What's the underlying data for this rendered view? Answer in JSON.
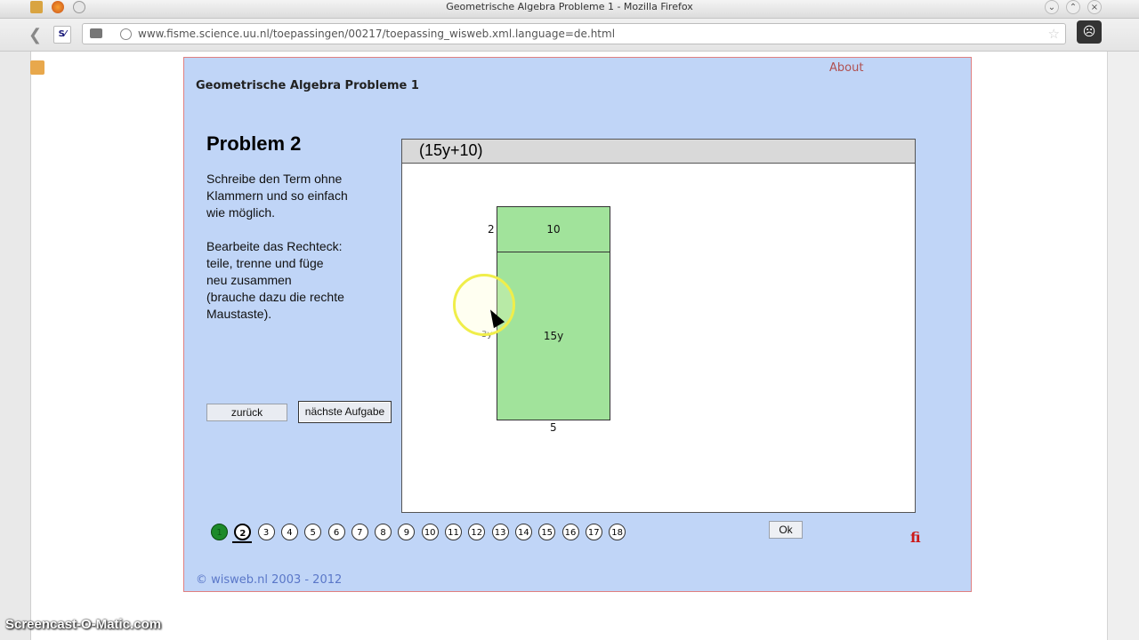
{
  "window": {
    "title": "Geometrische Algebra Probleme 1 - Mozilla Firefox",
    "controls": [
      "chevron-down-icon",
      "chevron-up-icon",
      "close-icon"
    ]
  },
  "navbar": {
    "addon_label": "S⁄",
    "url": "www.fisme.science.uu.nl/toepassingen/00217/toepassing_wisweb.xml.language=de.html"
  },
  "applet": {
    "about": "About",
    "title": "Geometrische Algebra Probleme 1",
    "problem_title": "Problem 2",
    "instructions": [
      "Schreibe den Term ohne\nKlammern und so einfach\nwie möglich.",
      "Bearbeite das Rechteck:\nteile, trenne und füge\nneu zusammen\n(brauche dazu die rechte\nMaustaste)."
    ],
    "back_label": "zurück",
    "next_label": "nächste Aufgabe",
    "expression": "(15y+10)",
    "rect_top_label": "10",
    "rect_bottom_label": "15y",
    "dim_height_top": "2",
    "dim_width": "5",
    "dim_height_bottom": "3y",
    "problems": [
      "1",
      "2",
      "3",
      "4",
      "5",
      "6",
      "7",
      "8",
      "9",
      "10",
      "11",
      "12",
      "13",
      "14",
      "15",
      "16",
      "17",
      "18"
    ],
    "completed_problem": "1",
    "current_problem": "2",
    "ok_label": "Ok",
    "copyright": "© wisweb.nl 2003 - 2012"
  },
  "watermark": "Screencast-O-Matic.com",
  "colors": {
    "applet_bg": "#c0d5f7",
    "rect_fill": "#a1e39b",
    "done_green": "#1d8a2a",
    "about_red": "#b05050"
  }
}
